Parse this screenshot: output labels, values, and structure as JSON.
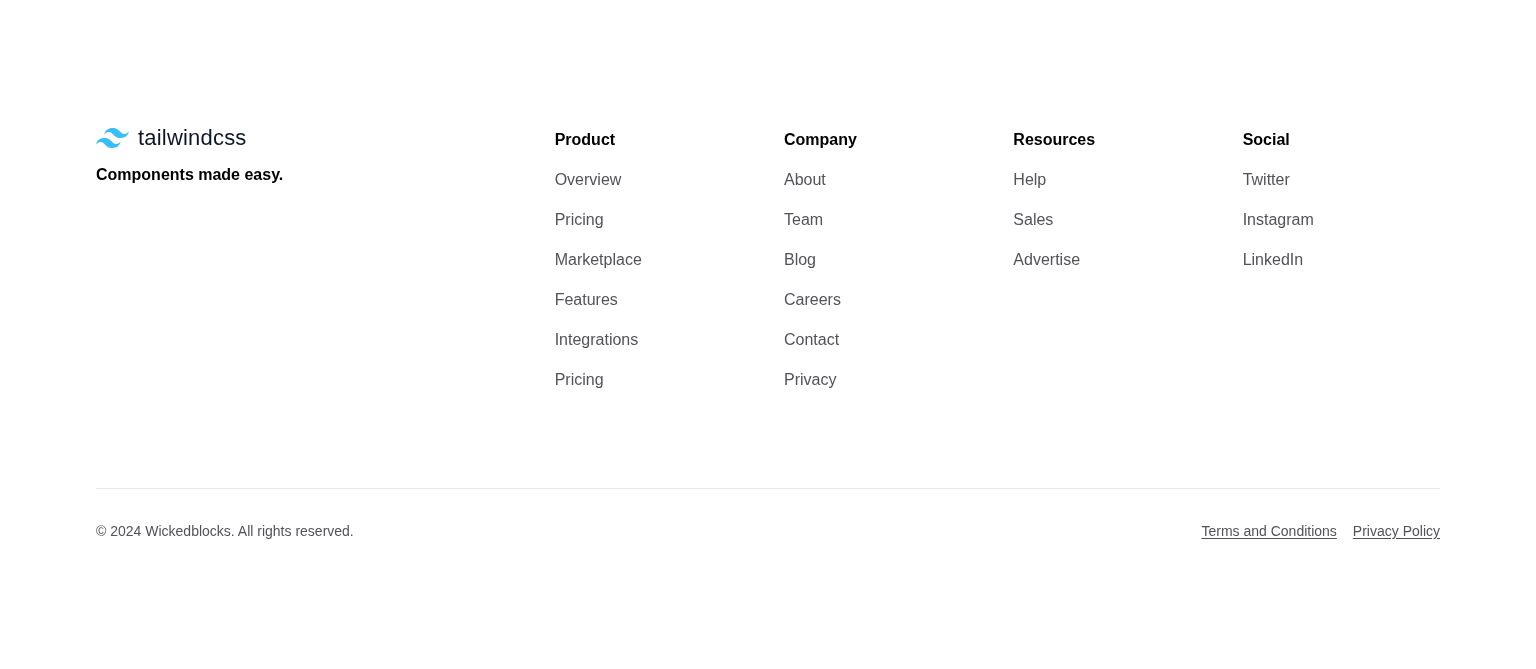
{
  "brand": {
    "name": "tailwindcss",
    "tagline": "Components made easy."
  },
  "columns": [
    {
      "heading": "Product",
      "links": [
        "Overview",
        "Pricing",
        "Marketplace",
        "Features",
        "Integrations",
        "Pricing"
      ]
    },
    {
      "heading": "Company",
      "links": [
        "About",
        "Team",
        "Blog",
        "Careers",
        "Contact",
        "Privacy"
      ]
    },
    {
      "heading": "Resources",
      "links": [
        "Help",
        "Sales",
        "Advertise"
      ]
    },
    {
      "heading": "Social",
      "links": [
        "Twitter",
        "Instagram",
        "LinkedIn"
      ]
    }
  ],
  "copyright": "© 2024 Wickedblocks. All rights reserved.",
  "legal_links": [
    "Terms and Conditions",
    "Privacy Policy"
  ]
}
